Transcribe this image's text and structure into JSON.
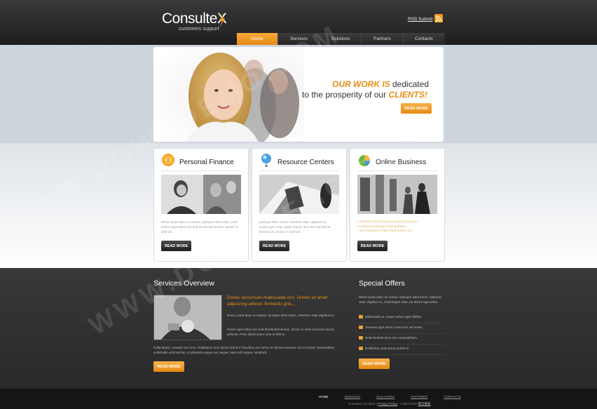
{
  "header": {
    "logo_main": "ConsulteX",
    "logo_sub": "customers support",
    "rss_label": "RSS Submit"
  },
  "nav": [
    {
      "label": "Home",
      "active": true
    },
    {
      "label": "Services",
      "active": false
    },
    {
      "label": "Solutions",
      "active": false
    },
    {
      "label": "Partners",
      "active": false
    },
    {
      "label": "Contacts",
      "active": false
    }
  ],
  "banner": {
    "headline_strong1": "OUR WORK IS",
    "headline_rest1": " dedicated",
    "headline_rest2": "to the prosperity of our ",
    "headline_strong2": "CLIENTS!",
    "button": "READ MORE"
  },
  "panels": [
    {
      "title": "Personal Finance",
      "icon": "coin-icon",
      "text": "Wisen porta diam eu massa. Quisque diam vitae, pede. Donec eget tellus non erat lacinia fermentum. Donec in velit vel...",
      "button": "READ MORE"
    },
    {
      "title": "Resource Centers",
      "icon": "pin-icon",
      "text": "Quisque diam lorem, interdum vitae, dapibus ac, scelerisque vitae, pede. Donec duo nisl erat lacinia fermentum. Donec in velit vel...",
      "button": "READ MORE"
    },
    {
      "title": "Online Business",
      "icon": "pie-chart-icon",
      "list": [
        "SEMPER PORTA DIAM EU MASSA QUISQUE",
        "LOREM INTERDUM VITAE DAPIBUS",
        "SCELERISQUE VITAE PEDE DONEC EG"
      ],
      "button": "READ MORE"
    }
  ],
  "services": {
    "title": "Services Overview",
    "quote": "Donec accumsan malesuada orci. Donec sit amet adipiscing ultrices fermentu gria....",
    "p1": "Donec porta diam eu massa. Quisque diam lorem, interdum vitae dapibus ac.",
    "p2": "Donec eget tellus non erat lacinia fermentum. Donec in velit vel ipsum auctor pulvinar. Proin ullamcorper urna et felis in.",
    "p3": "Nulla facilisi. Aenean nec eros. Vestibulum ante ipsum primis in faucibus orci luctus et ultrices posuere cub ia Curae; Suspendisse sollicitudin velit sed leo. Ut pharetra augue nec augue. Nam elit magna, hendrerit.",
    "button": "READ MORE"
  },
  "offers": {
    "title": "Special Offers",
    "text": "Wisen porta diam eu massa. Quisque diam lorem, interdum vitae, dapibus ac, scelerisque vitae, pe donec eget tellus",
    "items": [
      "Malesuada at, neque varius eget nibhha",
      "Vivamus eget etiam cursus leo vel metus",
      "Nulla facilisinonien non enaaestiblum",
      "Deltibulum ante ipsum primis in"
    ],
    "button": "READ MORE"
  },
  "footer": {
    "links": [
      "HOME",
      "SERVICES",
      "SOLUTIONS",
      "PARTNERS",
      "CONTACTS"
    ],
    "copy": "ConsulteX (c) 2010 | ",
    "privacy": "Privacy Policy",
    "collect": " - Collect from ",
    "collect_link": "网页模板"
  },
  "watermark": "WWW.DOWNDEMO.COM",
  "colors": {
    "accent": "#e88e15",
    "dark": "#2a2a2a",
    "band": "#cdd4dc"
  }
}
